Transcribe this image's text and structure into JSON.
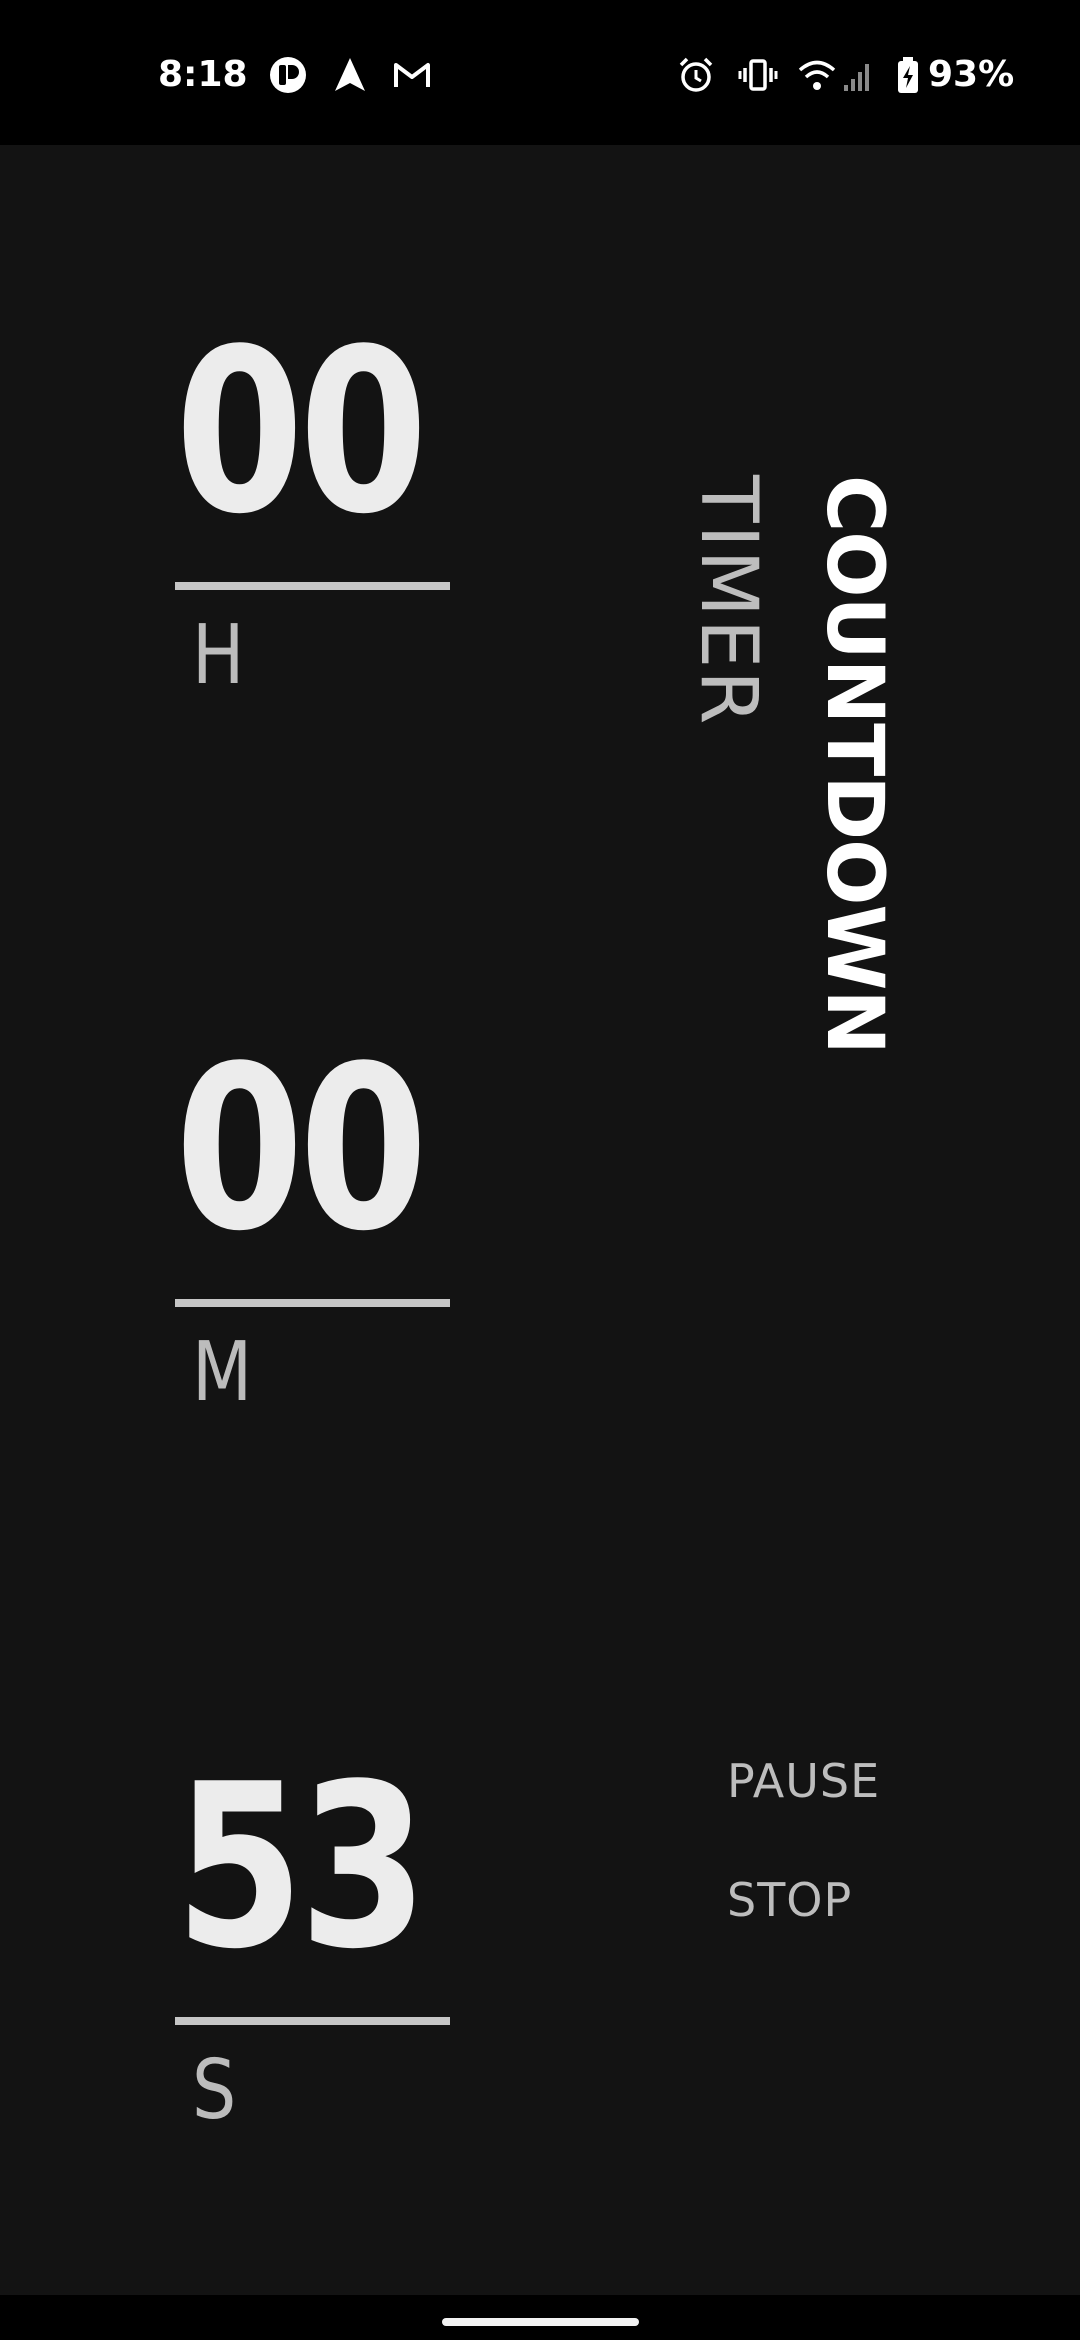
{
  "status_bar": {
    "time": "8:18",
    "battery": "93%",
    "notification_icons": [
      "p-app-icon",
      "arrow-navigation-icon",
      "gmail-icon"
    ],
    "system_icons": [
      "alarm-icon",
      "vibrate-icon",
      "wifi-icon",
      "signal-icon",
      "battery-charging-icon"
    ]
  },
  "title": {
    "line1": "COUNTDOWN",
    "line2": "TIMER"
  },
  "timer": {
    "hours": "00",
    "hours_unit": "H",
    "minutes": "00",
    "minutes_unit": "M",
    "seconds": "53",
    "seconds_unit": "S"
  },
  "actions": {
    "pause_label": "PAUSE",
    "stop_label": "STOP"
  },
  "colors": {
    "background": "#131313",
    "digits": "#ececec",
    "labels": "#bdbdbd"
  }
}
